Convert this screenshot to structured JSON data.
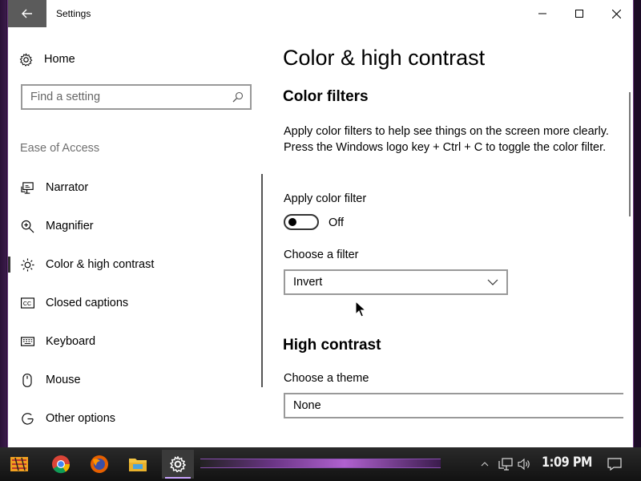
{
  "window": {
    "title": "Settings",
    "controls": {
      "minimize": "minimize-icon",
      "maximize": "maximize-icon",
      "close": "close-icon"
    }
  },
  "sidebar": {
    "home_label": "Home",
    "search_placeholder": "Find a setting",
    "section_label": "Ease of Access",
    "items": [
      {
        "label": "Narrator",
        "icon": "narrator-icon",
        "selected": false
      },
      {
        "label": "Magnifier",
        "icon": "magnifier-icon",
        "selected": false
      },
      {
        "label": "Color & high contrast",
        "icon": "brightness-icon",
        "selected": true
      },
      {
        "label": "Closed captions",
        "icon": "closed-captions-icon",
        "selected": false
      },
      {
        "label": "Keyboard",
        "icon": "keyboard-icon",
        "selected": false
      },
      {
        "label": "Mouse",
        "icon": "mouse-icon",
        "selected": false
      },
      {
        "label": "Other options",
        "icon": "other-options-icon",
        "selected": false
      }
    ]
  },
  "main": {
    "page_title": "Color & high contrast",
    "color_filters": {
      "heading": "Color filters",
      "description": "Apply color filters to help see things on the screen more clearly. Press the Windows logo key + Ctrl + C to toggle the color filter.",
      "apply_label": "Apply color filter",
      "toggle_state": "Off",
      "choose_label": "Choose a filter",
      "filter_value": "Invert"
    },
    "high_contrast": {
      "heading": "High contrast",
      "choose_label": "Choose a theme",
      "theme_value": "None"
    }
  },
  "taskbar": {
    "apps": [
      "start-icon",
      "chrome-icon",
      "firefox-icon",
      "file-explorer-icon",
      "settings-icon"
    ],
    "active_app": "settings-icon",
    "tray": [
      "chevron-up-icon",
      "network-icon",
      "volume-icon"
    ],
    "clock": "1:09 PM",
    "notification": "action-center-icon"
  },
  "colors": {
    "accent_back": "#5b5b5b",
    "text": "#000000",
    "section_gray": "#707070",
    "taskbar": "#1a1a1a",
    "wallpaper_purple": "#b061d0"
  }
}
